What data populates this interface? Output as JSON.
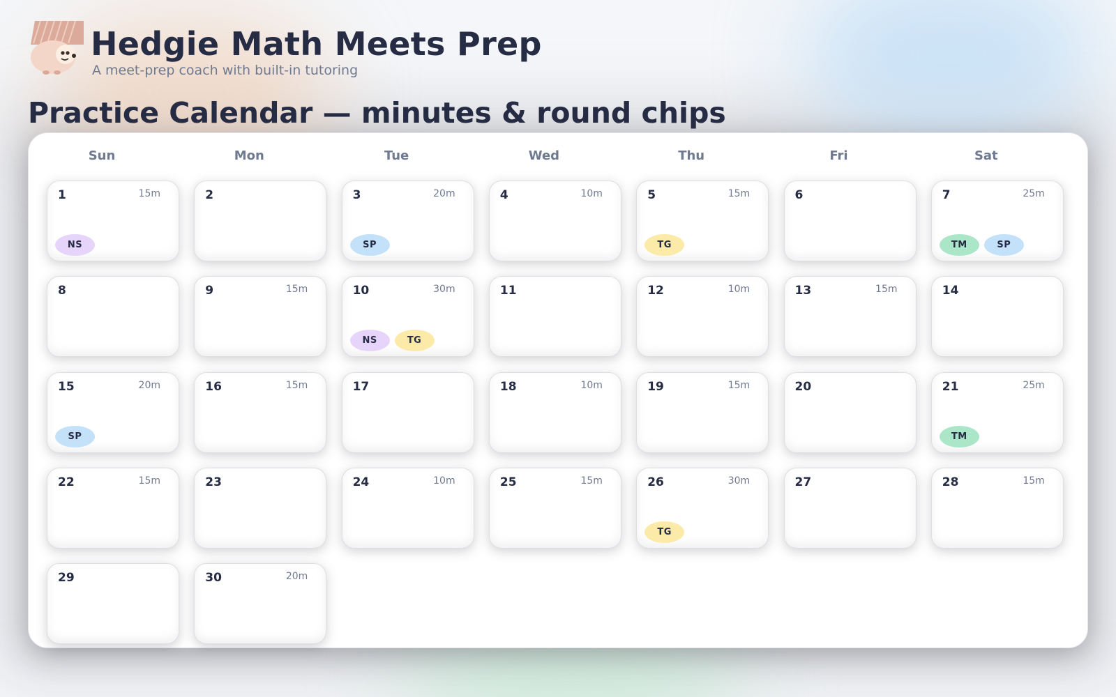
{
  "app": {
    "title": "Hedgie Math Meets Prep",
    "subtitle": "A meet-prep coach with built-in tutoring",
    "logo_icon": "hedgehog-icon"
  },
  "page_title": "Practice Calendar — minutes & round chips",
  "colors": {
    "text_dark": "#262c44",
    "text_muted": "#6f7a90",
    "chip_NS": "#e7d4fa",
    "chip_SP": "#c4e1fa",
    "chip_TG": "#fceaa8",
    "chip_TM": "#abe6c8"
  },
  "weekdays": [
    "Sun",
    "Mon",
    "Tue",
    "Wed",
    "Thu",
    "Fri",
    "Sat"
  ],
  "days": [
    {
      "day": "1",
      "minutes": "15m",
      "chips": [
        "NS"
      ]
    },
    {
      "day": "2",
      "minutes": "",
      "chips": []
    },
    {
      "day": "3",
      "minutes": "20m",
      "chips": [
        "SP"
      ]
    },
    {
      "day": "4",
      "minutes": "10m",
      "chips": []
    },
    {
      "day": "5",
      "minutes": "15m",
      "chips": [
        "TG"
      ]
    },
    {
      "day": "6",
      "minutes": "",
      "chips": []
    },
    {
      "day": "7",
      "minutes": "25m",
      "chips": [
        "TM",
        "SP"
      ]
    },
    {
      "day": "8",
      "minutes": "",
      "chips": []
    },
    {
      "day": "9",
      "minutes": "15m",
      "chips": []
    },
    {
      "day": "10",
      "minutes": "30m",
      "chips": [
        "NS",
        "TG"
      ]
    },
    {
      "day": "11",
      "minutes": "",
      "chips": []
    },
    {
      "day": "12",
      "minutes": "10m",
      "chips": []
    },
    {
      "day": "13",
      "minutes": "15m",
      "chips": []
    },
    {
      "day": "14",
      "minutes": "",
      "chips": []
    },
    {
      "day": "15",
      "minutes": "20m",
      "chips": [
        "SP"
      ]
    },
    {
      "day": "16",
      "minutes": "15m",
      "chips": []
    },
    {
      "day": "17",
      "minutes": "",
      "chips": []
    },
    {
      "day": "18",
      "minutes": "10m",
      "chips": []
    },
    {
      "day": "19",
      "minutes": "15m",
      "chips": []
    },
    {
      "day": "20",
      "minutes": "",
      "chips": []
    },
    {
      "day": "21",
      "minutes": "25m",
      "chips": [
        "TM"
      ]
    },
    {
      "day": "22",
      "minutes": "15m",
      "chips": []
    },
    {
      "day": "23",
      "minutes": "",
      "chips": []
    },
    {
      "day": "24",
      "minutes": "10m",
      "chips": []
    },
    {
      "day": "25",
      "minutes": "15m",
      "chips": []
    },
    {
      "day": "26",
      "minutes": "30m",
      "chips": [
        "TG"
      ]
    },
    {
      "day": "27",
      "minutes": "",
      "chips": []
    },
    {
      "day": "28",
      "minutes": "15m",
      "chips": []
    },
    {
      "day": "29",
      "minutes": "",
      "chips": []
    },
    {
      "day": "30",
      "minutes": "20m",
      "chips": []
    }
  ]
}
